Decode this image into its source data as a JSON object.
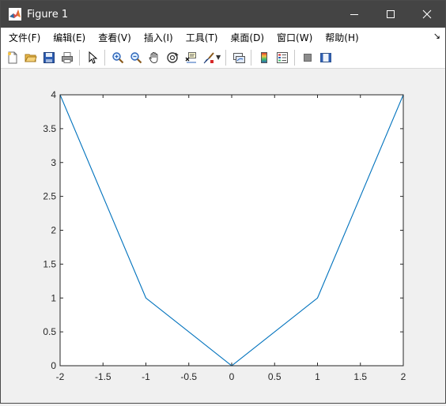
{
  "window": {
    "title": "Figure 1",
    "controls": {
      "minimize": "minimize",
      "maximize": "maximize",
      "close": "close"
    }
  },
  "menubar": {
    "items": [
      {
        "label": "文件(F)",
        "name": "menu-file"
      },
      {
        "label": "编辑(E)",
        "name": "menu-edit"
      },
      {
        "label": "查看(V)",
        "name": "menu-view"
      },
      {
        "label": "插入(I)",
        "name": "menu-insert"
      },
      {
        "label": "工具(T)",
        "name": "menu-tools"
      },
      {
        "label": "桌面(D)",
        "name": "menu-desktop"
      },
      {
        "label": "窗口(W)",
        "name": "menu-window"
      },
      {
        "label": "帮助(H)",
        "name": "menu-help"
      }
    ],
    "overflow_glyph": "↘"
  },
  "toolbar": {
    "icons": [
      "new-figure-icon",
      "open-file-icon",
      "save-icon",
      "print-icon",
      "pointer-icon",
      "zoom-in-icon",
      "zoom-out-icon",
      "pan-icon",
      "rotate-3d-icon",
      "data-cursor-icon",
      "brush-icon",
      "link-plot-icon",
      "colorbar-icon",
      "legend-icon",
      "hide-plot-tools-icon",
      "show-plot-tools-icon"
    ]
  },
  "chart_data": {
    "type": "line",
    "x": [
      -2,
      -1,
      0,
      1,
      2
    ],
    "series": [
      {
        "values": [
          4,
          1,
          0,
          1,
          4
        ],
        "color": "#0072bd"
      }
    ],
    "xlim": [
      -2,
      2
    ],
    "ylim": [
      0,
      4
    ],
    "xticks": [
      -2,
      -1.5,
      -1,
      -0.5,
      0,
      0.5,
      1,
      1.5,
      2
    ],
    "xtick_labels": [
      "-2",
      "-1.5",
      "-1",
      "-0.5",
      "0",
      "0.5",
      "1",
      "1.5",
      "2"
    ],
    "yticks": [
      0,
      0.5,
      1,
      1.5,
      2,
      2.5,
      3,
      3.5,
      4
    ],
    "ytick_labels": [
      "0",
      "0.5",
      "1",
      "1.5",
      "2",
      "2.5",
      "3",
      "3.5",
      "4"
    ],
    "grid": false,
    "box": true,
    "title": "",
    "xlabel": "",
    "ylabel": ""
  }
}
